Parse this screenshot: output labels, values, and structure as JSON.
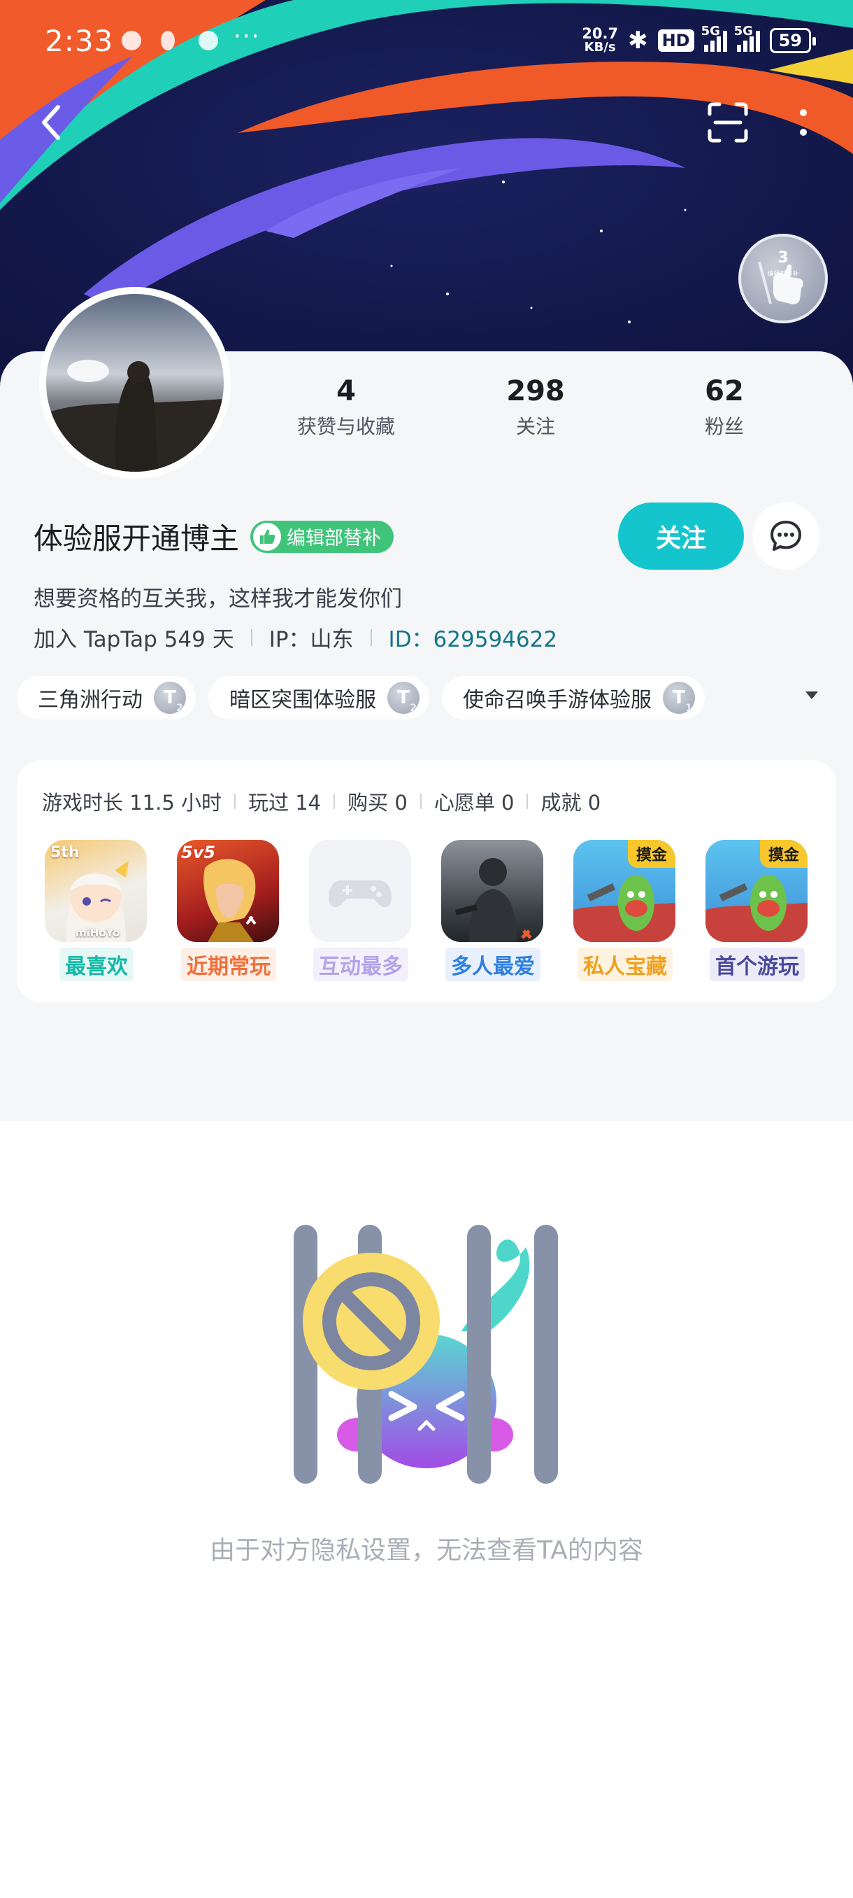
{
  "status_bar": {
    "time": "2:33",
    "dots": "···",
    "speed_top": "20.7",
    "speed_bottom": "KB/s",
    "hd": "HD",
    "net1": "5G",
    "net2": "5G",
    "battery": "59"
  },
  "header": {
    "medal_number": "3",
    "medal_text": "编辑部替补"
  },
  "profile": {
    "name": "体验服开通博主",
    "role_tag": "编辑部替补",
    "follow_label": "关注",
    "bio": "想要资格的互关我，这样我才能发你们",
    "join_text": "加入 TapTap 549 天",
    "ip_text": "IP：山东",
    "id_text": "ID：629594622"
  },
  "stats": [
    {
      "value": "4",
      "label": "获赞与收藏"
    },
    {
      "value": "298",
      "label": "关注"
    },
    {
      "value": "62",
      "label": "粉丝"
    }
  ],
  "chips": [
    {
      "label": "三角洲行动",
      "level": "2"
    },
    {
      "label": "暗区突围体验服",
      "level": "2"
    },
    {
      "label": "使命召唤手游体验服",
      "level": "1"
    }
  ],
  "games": {
    "stats": [
      "游戏时长 11.5 小时",
      "玩过 14",
      "购买 0",
      "心愿单 0",
      "成就 0"
    ],
    "items": [
      {
        "label": "最喜欢",
        "color": "#14b8a6",
        "bg": "#e6f8f6"
      },
      {
        "label": "近期常玩",
        "color": "#f0703a",
        "bg": "#fdeee6"
      },
      {
        "label": "互动最多",
        "color": "#b1a4e8",
        "bg": "#f3f0fc"
      },
      {
        "label": "多人最爱",
        "color": "#2f7fe0",
        "bg": "#e7f0fc"
      },
      {
        "label": "私人宝藏",
        "color": "#f0a020",
        "bg": "#fdf3e0"
      },
      {
        "label": "首个游玩",
        "color": "#4a4a9c",
        "bg": "#ecebf7"
      }
    ],
    "badge_text": "摸金",
    "icon_texts": {
      "genshin_top": "5th",
      "genshin_bottom": "miHoYo",
      "hok": "5v5"
    }
  },
  "privacy": {
    "message": "由于对方隐私设置，无法查看TA的内容"
  }
}
